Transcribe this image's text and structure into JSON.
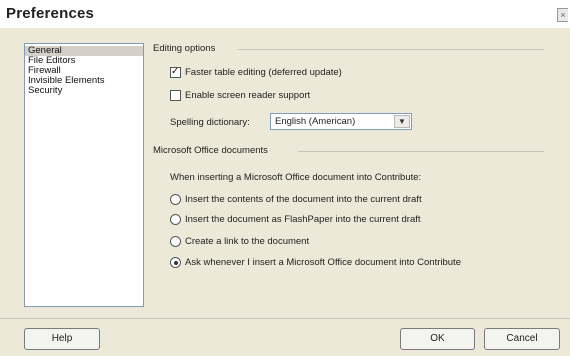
{
  "window": {
    "title": "Preferences",
    "close_glyph": "×"
  },
  "categories": [
    {
      "label": "General",
      "selected": true
    },
    {
      "label": "File Editors",
      "selected": false
    },
    {
      "label": "Firewall",
      "selected": false
    },
    {
      "label": "Invisible Elements",
      "selected": false
    },
    {
      "label": "Security",
      "selected": false
    }
  ],
  "editing_options": {
    "heading": "Editing options",
    "faster_table_editing": {
      "label": "Faster table editing (deferred update)",
      "checked": true
    },
    "screen_reader": {
      "label": "Enable screen reader support",
      "checked": false
    },
    "spelling": {
      "label": "Spelling dictionary:",
      "value": "English (American)"
    }
  },
  "office_documents": {
    "heading": "Microsoft Office documents",
    "prompt": "When inserting a Microsoft Office document into Contribute:",
    "options": [
      {
        "label": "Insert the contents of the document into the current draft",
        "selected": false
      },
      {
        "label": "Insert the document as FlashPaper into the current draft",
        "selected": false
      },
      {
        "label": "Create a link to the document",
        "selected": false
      },
      {
        "label": "Ask whenever I insert a Microsoft Office document into Contribute",
        "selected": true
      }
    ]
  },
  "buttons": {
    "help": "Help",
    "ok": "OK",
    "cancel": "Cancel"
  },
  "icons": {
    "checkmark": "✓",
    "dropdown": "▼"
  }
}
